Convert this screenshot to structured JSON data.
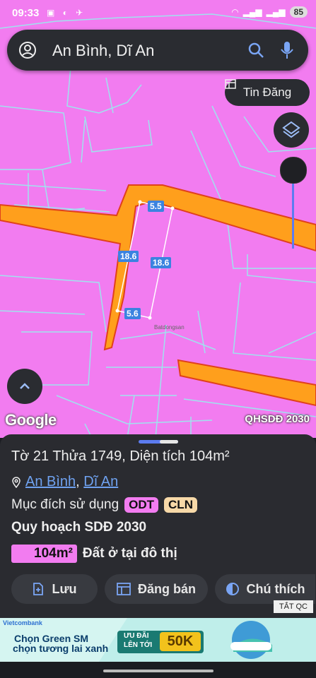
{
  "status_bar": {
    "time": "09:33",
    "battery": "85"
  },
  "search": {
    "place": "An Bình, Dĩ An"
  },
  "map": {
    "tin_dang_label": "Tin Đăng",
    "attribution": "Google",
    "layer_name": "QHSDĐ 2030",
    "watermark": "Batdongsan",
    "dimensions": {
      "top": "5.5",
      "left": "18.6",
      "right": "18.6",
      "bottom": "5.6"
    }
  },
  "panel": {
    "line1": "Tờ 21 Thửa 1749, Diện tích 104m²",
    "ward": "An Bình",
    "city": "Dĩ An",
    "comma": ",",
    "purpose_label": "Mục đích sử dụng",
    "badges": [
      "ODT",
      "CLN"
    ],
    "plan_title": "Quy hoạch SDĐ 2030",
    "area_value": "104m²",
    "area_desc": "Đất ở tại đô thị",
    "buttons": {
      "save": "Lưu",
      "sell": "Đăng bán",
      "legend": "Chú thích"
    },
    "ad_close": "TẮT QC"
  },
  "ad": {
    "brand": "Vietcombank",
    "line1": "Chọn Green SM",
    "line2": "chọn tương lai xanh",
    "promo1": "ƯU ĐÃI",
    "promo2": "LÊN TỚI",
    "promo_value": "50K"
  },
  "colors": {
    "land_residential": "#f27cf0",
    "road": "#ff9f1c",
    "accent": "#5c7cf0"
  }
}
